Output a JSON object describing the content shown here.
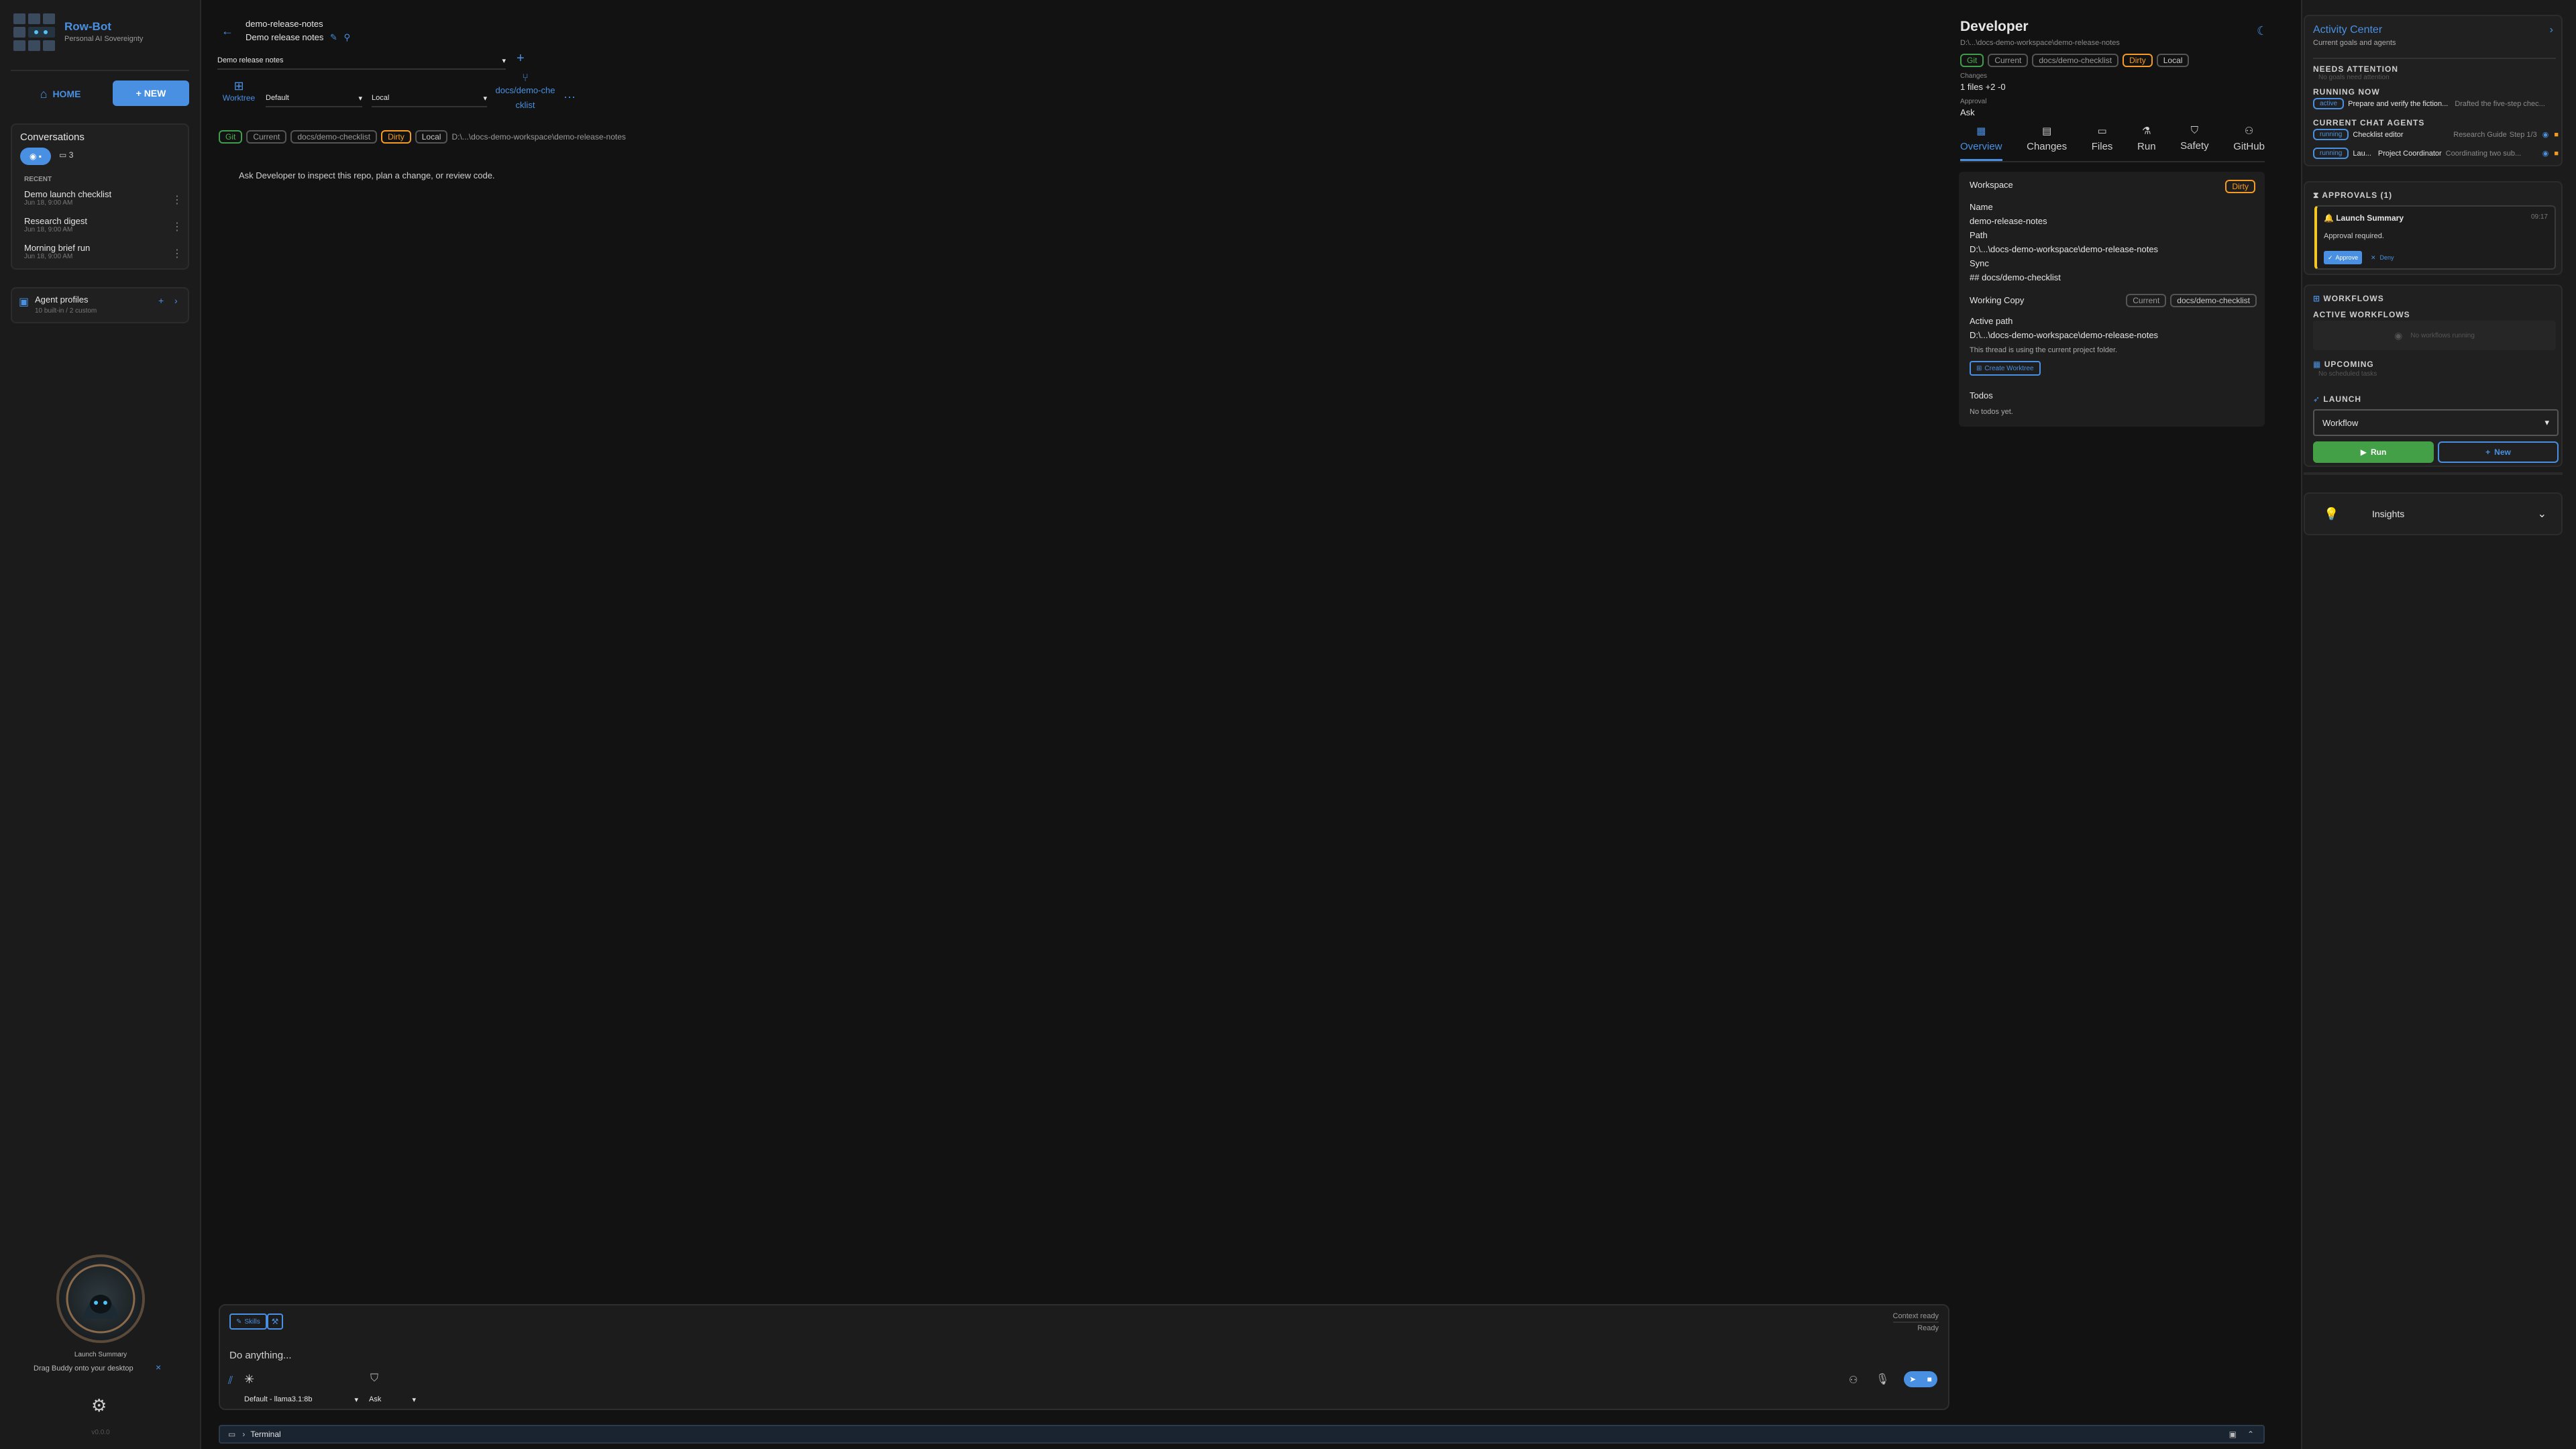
{
  "app": {
    "name": "Row-Bot",
    "tagline": "Personal AI Sovereignty",
    "version": "v0.0.0"
  },
  "nav": {
    "home": "HOME",
    "new": "+ NEW"
  },
  "conversations": {
    "title": "Conversations",
    "chat_count": "3",
    "recent_label": "RECENT",
    "items": [
      {
        "title": "Demo launch checklist",
        "time": "Jun 18, 9:00 AM"
      },
      {
        "title": "Research digest",
        "time": "Jun 18, 9:00 AM"
      },
      {
        "title": "Morning brief run",
        "time": "Jun 18, 9:00 AM"
      }
    ]
  },
  "agent_profiles": {
    "title": "Agent profiles",
    "subtitle": "10 built-in / 2 custom"
  },
  "buddy": {
    "label": "Launch Summary",
    "hint": "Drag Buddy onto your desktop",
    "close": "×"
  },
  "thread": {
    "repo": "demo-release-notes",
    "title": "Demo release notes",
    "project_select": "Demo release notes",
    "worktree_label": "Worktree",
    "profile_select": "Default",
    "location_select": "Local",
    "branch": "docs/demo-checklist",
    "tags": [
      "Git",
      "Current",
      "docs/demo-checklist",
      "Dirty",
      "Local"
    ],
    "path": "D:\\...\\docs-demo-workspace\\demo-release-notes",
    "intro": "Ask Developer to inspect this repo, plan a change, or review code."
  },
  "composer": {
    "skills_label": "Skills",
    "context_status": "Context ready",
    "ready": "Ready",
    "placeholder": "Do anything...",
    "model_select": "Default - llama3.1:8b",
    "mode_select": "Ask"
  },
  "terminal": {
    "label": "Terminal"
  },
  "developer": {
    "title": "Developer",
    "path": "D:\\...\\docs-demo-workspace\\demo-release-notes",
    "tags": [
      "Git",
      "Current",
      "docs/demo-checklist",
      "Dirty",
      "Local"
    ],
    "changes_label": "Changes",
    "changes_value": "1 files +2 -0",
    "approval_label": "Approval",
    "approval_value": "Ask",
    "tabs": [
      "Overview",
      "Changes",
      "Files",
      "Run",
      "Safety",
      "GitHub"
    ],
    "workspace": {
      "title": "Workspace",
      "badge": "Dirty",
      "name_label": "Name",
      "name_value": "demo-release-notes",
      "path_label": "Path",
      "path_value": "D:\\...\\docs-demo-workspace\\demo-release-notes",
      "sync_label": "Sync",
      "sync_value": "## docs/demo-checklist"
    },
    "working_copy": {
      "title": "Working Copy",
      "tag_current": "Current",
      "tag_branch": "docs/demo-checklist",
      "active_label": "Active path",
      "active_value": "D:\\...\\docs-demo-workspace\\demo-release-notes",
      "note": "This thread is using the current project folder.",
      "create_btn": "Create Worktree"
    },
    "todos": {
      "title": "Todos",
      "empty": "No todos yet."
    }
  },
  "activity": {
    "title": "Activity Center",
    "subtitle": "Current goals and agents",
    "needs_attention": "NEEDS ATTENTION",
    "needs_attention_empty": "No goals need attention",
    "running_now": "RUNNING NOW",
    "running_item": {
      "status": "active",
      "title": "Prepare and verify the fiction...",
      "detail": "Drafted the five-step chec..."
    },
    "current_agents": "CURRENT CHAT AGENTS",
    "agents": [
      {
        "status": "running",
        "name": "Checklist editor",
        "role": "Research Guide",
        "detail": "Step 1/3"
      },
      {
        "status": "running",
        "name": "Lau...",
        "role": "Project Coordinator",
        "detail": "Coordinating two sub..."
      }
    ],
    "approvals": {
      "title": "APPROVALS (1)",
      "item_title": "Launch Summary",
      "item_time": "09:17",
      "item_detail": "Approval required.",
      "approve": "Approve",
      "deny": "Deny"
    },
    "workflows": {
      "title": "WORKFLOWS",
      "active": "ACTIVE WORKFLOWS",
      "active_empty": "No workflows running",
      "upcoming": "UPCOMING",
      "upcoming_empty": "No scheduled tasks",
      "launch": "LAUNCH",
      "select": "Workflow",
      "run": "Run",
      "new": "New"
    },
    "insights": "Insights"
  }
}
